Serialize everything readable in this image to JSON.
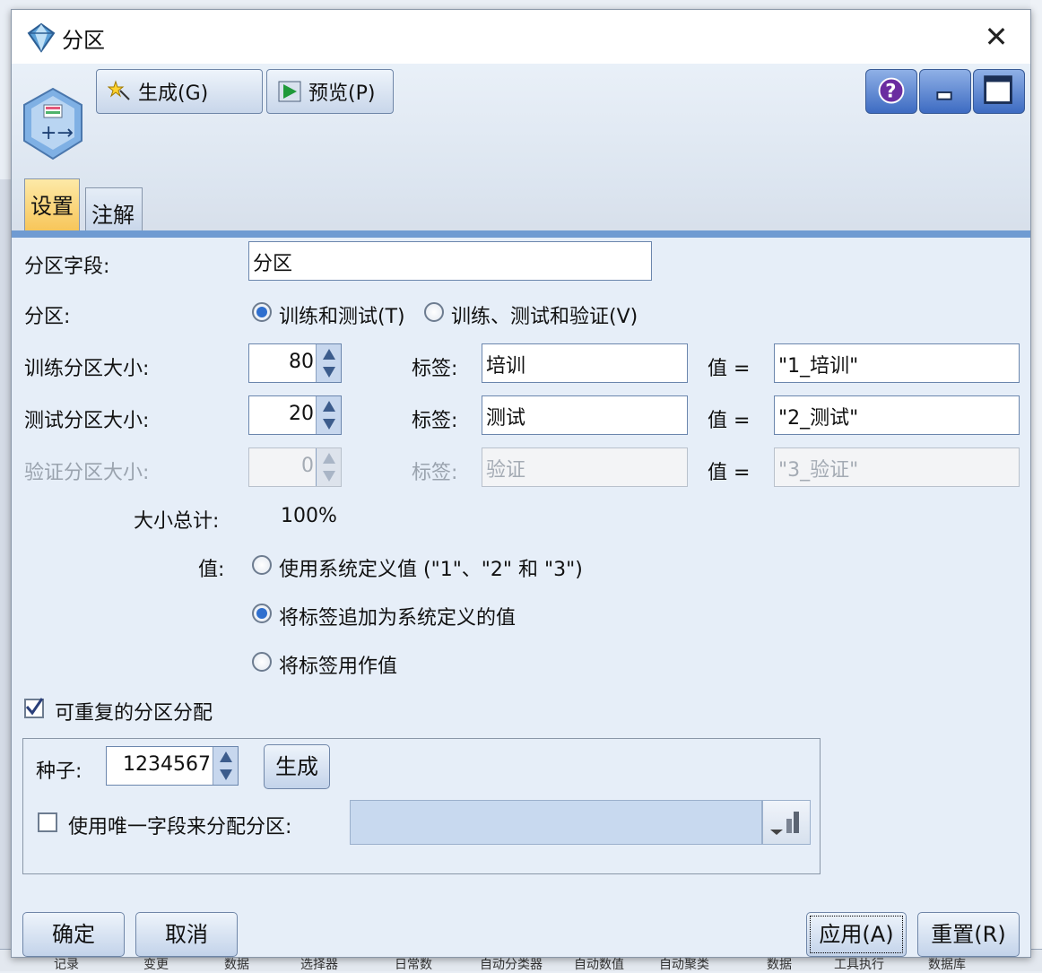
{
  "window": {
    "title": "分区",
    "close_glyph": "✕"
  },
  "toolbar": {
    "generate": "生成(G)",
    "preview": "预览(P)",
    "help_glyph": "?"
  },
  "tabs": [
    {
      "label": "设置",
      "active": true
    },
    {
      "label": "注解",
      "active": false
    }
  ],
  "form": {
    "partition_field_label": "分区字段:",
    "partition_field_value": "分区",
    "partition_label": "分区:",
    "partition_options": [
      {
        "label": "训练和测试(T)",
        "selected": true
      },
      {
        "label": "训练、测试和验证(V)",
        "selected": false
      }
    ],
    "rows": [
      {
        "label": "训练分区大小:",
        "size": "80",
        "tag_label": "标签:",
        "tag": "培训",
        "value_label": "值 =",
        "value": "\"1_培训\"",
        "enabled": true
      },
      {
        "label": "测试分区大小:",
        "size": "20",
        "tag_label": "标签:",
        "tag": "测试",
        "value_label": "值 =",
        "value": "\"2_测试\"",
        "enabled": true
      },
      {
        "label": "验证分区大小:",
        "size": "0",
        "tag_label": "标签:",
        "tag": "验证",
        "value_label": "值 =",
        "value": "\"3_验证\"",
        "enabled": false
      }
    ],
    "total_label": "大小总计:",
    "total_value": "100%",
    "values_label": "值:",
    "value_options": [
      {
        "label": "使用系统定义值 (\"1\"、\"2\" 和 \"3\")",
        "selected": false
      },
      {
        "label": "将标签追加为系统定义的值",
        "selected": true
      },
      {
        "label": "将标签用作值",
        "selected": false
      }
    ],
    "repeatable_label": "可重复的分区分配",
    "repeatable_checked": true,
    "seed_label": "种子:",
    "seed_value": "1234567",
    "seed_generate": "生成",
    "unique_field_label": "使用唯一字段来分配分区:",
    "unique_field_checked": false
  },
  "footer": {
    "ok": "确定",
    "cancel": "取消",
    "apply": "应用(A)",
    "reset": "重置(R)"
  },
  "background_bar": [
    "记录",
    "变更",
    "数据",
    "选择器",
    "日常数",
    "自动分类器",
    "自动数值",
    "自动聚类",
    "数据",
    "工具执行",
    "数据库"
  ],
  "colors": {
    "accent": "#2f6fce",
    "tab_active": "#f7c65a",
    "tab_line": "#6f9bd2"
  }
}
